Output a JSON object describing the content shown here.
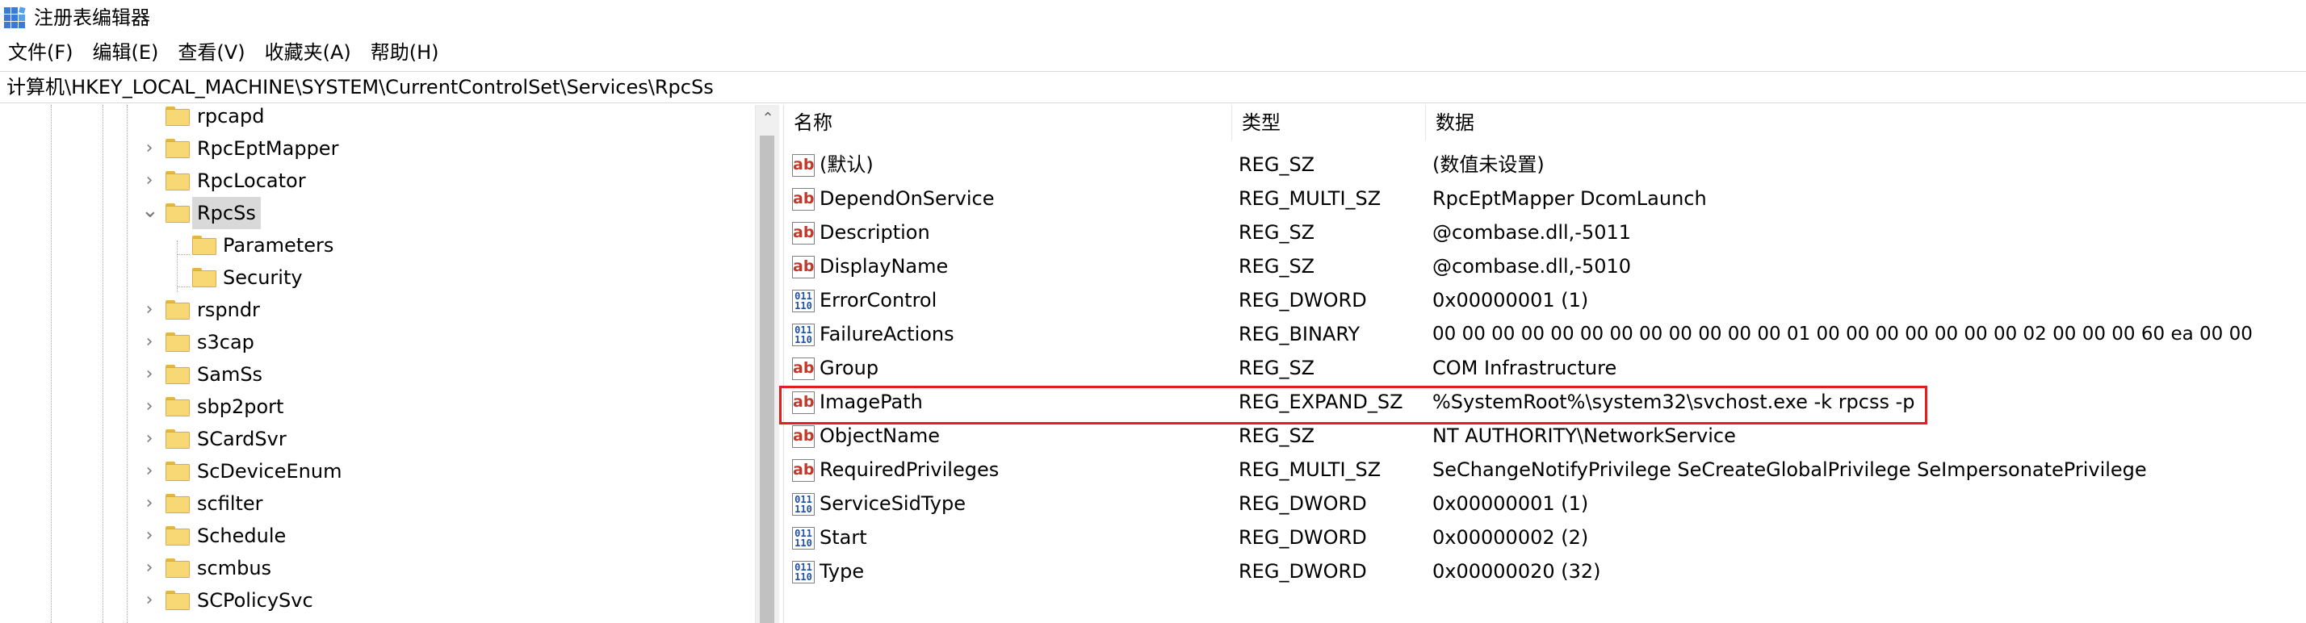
{
  "window": {
    "title": "注册表编辑器"
  },
  "menu": [
    "文件(F)",
    "编辑(E)",
    "查看(V)",
    "收藏夹(A)",
    "帮助(H)"
  ],
  "address": "计算机\\HKEY_LOCAL_MACHINE\\SYSTEM\\CurrentControlSet\\Services\\RpcSs",
  "tree": {
    "items": [
      {
        "label": "rpcapd",
        "expanded": null
      },
      {
        "label": "RpcEptMapper",
        "expanded": false
      },
      {
        "label": "RpcLocator",
        "expanded": false
      },
      {
        "label": "RpcSs",
        "expanded": true,
        "selected": true
      },
      {
        "label": "Parameters",
        "child": true
      },
      {
        "label": "Security",
        "child": true
      },
      {
        "label": "rspndr",
        "expanded": false
      },
      {
        "label": "s3cap",
        "expanded": false
      },
      {
        "label": "SamSs",
        "expanded": false
      },
      {
        "label": "sbp2port",
        "expanded": false
      },
      {
        "label": "SCardSvr",
        "expanded": false
      },
      {
        "label": "ScDeviceEnum",
        "expanded": false
      },
      {
        "label": "scfilter",
        "expanded": false
      },
      {
        "label": "Schedule",
        "expanded": false
      },
      {
        "label": "scmbus",
        "expanded": false
      },
      {
        "label": "SCPolicySvc",
        "expanded": false
      }
    ]
  },
  "list": {
    "columns": [
      "名称",
      "类型",
      "数据"
    ],
    "rows": [
      {
        "icon": "string-value-icon",
        "name": "(默认)",
        "type": "REG_SZ",
        "data": "(数值未设置)"
      },
      {
        "icon": "string-value-icon",
        "name": "DependOnService",
        "type": "REG_MULTI_SZ",
        "data": "RpcEptMapper DcomLaunch"
      },
      {
        "icon": "string-value-icon",
        "name": "Description",
        "type": "REG_SZ",
        "data": "@combase.dll,-5011"
      },
      {
        "icon": "string-value-icon",
        "name": "DisplayName",
        "type": "REG_SZ",
        "data": "@combase.dll,-5010"
      },
      {
        "icon": "binary-value-icon",
        "name": "ErrorControl",
        "type": "REG_DWORD",
        "data": "0x00000001 (1)"
      },
      {
        "icon": "binary-value-icon",
        "name": "FailureActions",
        "type": "REG_BINARY",
        "data": "00 00 00 00 00 00 00 00 00 00 00 00 01 00 00 00 00 00 00 00 02 00 00 00 60 ea 00 00"
      },
      {
        "icon": "string-value-icon",
        "name": "Group",
        "type": "REG_SZ",
        "data": "COM Infrastructure"
      },
      {
        "icon": "string-value-icon",
        "name": "ImagePath",
        "type": "REG_EXPAND_SZ",
        "data": "%SystemRoot%\\system32\\svchost.exe -k rpcss -p",
        "highlighted": true
      },
      {
        "icon": "string-value-icon",
        "name": "ObjectName",
        "type": "REG_SZ",
        "data": "NT AUTHORITY\\NetworkService"
      },
      {
        "icon": "string-value-icon",
        "name": "RequiredPrivileges",
        "type": "REG_MULTI_SZ",
        "data": "SeChangeNotifyPrivilege SeCreateGlobalPrivilege SeImpersonatePrivilege"
      },
      {
        "icon": "binary-value-icon",
        "name": "ServiceSidType",
        "type": "REG_DWORD",
        "data": "0x00000001 (1)"
      },
      {
        "icon": "binary-value-icon",
        "name": "Start",
        "type": "REG_DWORD",
        "data": "0x00000002 (2)"
      },
      {
        "icon": "binary-value-icon",
        "name": "Type",
        "type": "REG_DWORD",
        "data": "0x00000020 (32)"
      }
    ]
  },
  "colors": {
    "highlight_border": "#e02020",
    "selection": "#d9d9d9",
    "folder": "#f8d775"
  },
  "icon_glyphs": {
    "string": "ab",
    "binary": "011\n110",
    "collapsed": "›",
    "expanded": "⌄",
    "scroll_up": "⌃"
  }
}
